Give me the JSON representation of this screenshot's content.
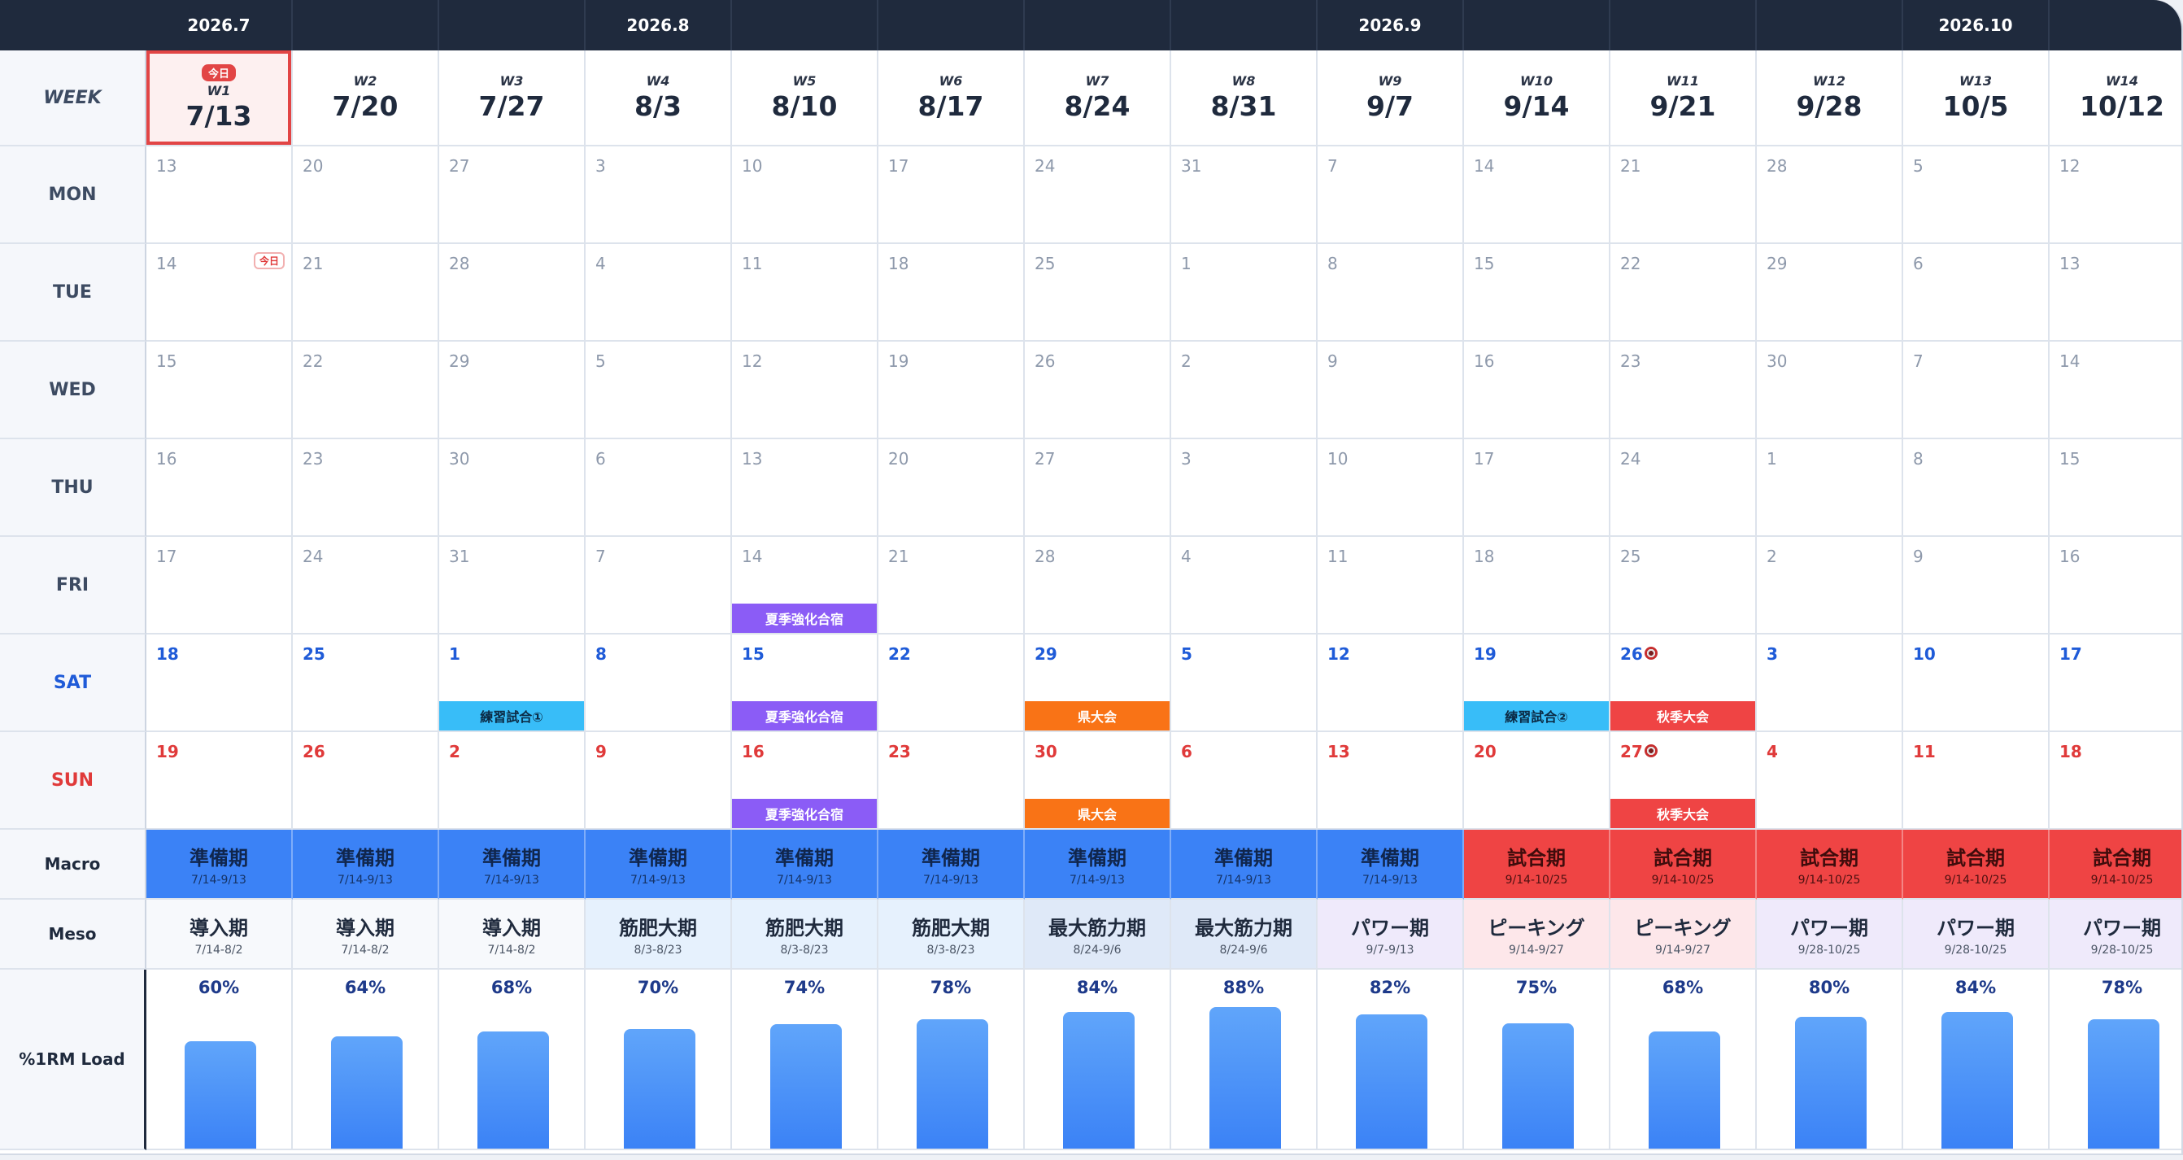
{
  "months": [
    {
      "label": "2026.7",
      "col": 1
    },
    {
      "label": "2026.8",
      "col": 4
    },
    {
      "label": "2026.9",
      "col": 9
    },
    {
      "label": "2026.10",
      "col": 13
    }
  ],
  "labels": {
    "week": "WEEK",
    "days": [
      "MON",
      "TUE",
      "WED",
      "THU",
      "FRI",
      "SAT",
      "SUN"
    ],
    "macro": "Macro",
    "meso": "Meso",
    "load": "%1RM Load",
    "today_badge": "今日",
    "today_tag": "今日"
  },
  "colors": {
    "header_bg": "#1f2a3d",
    "today_outline": "#e24545",
    "macro_prep": "#3b82f6",
    "macro_comp": "#ef4444",
    "event_camp": "#8b5cf6",
    "event_practice": "#38bdf8",
    "event_prefectural": "#f97316",
    "event_autumn": "#ef4444"
  },
  "weeks": [
    {
      "no": "W1",
      "date": "7/13",
      "today": true,
      "days": [
        "13",
        "14",
        "15",
        "16",
        "17",
        "18",
        "19"
      ],
      "macro": {
        "name": "準備期",
        "range": "7/14-9/13",
        "type": "blue"
      },
      "meso": {
        "name": "導入期",
        "range": "7/14-8/2",
        "bg": "#f7f9fc"
      },
      "load": 60,
      "load_label": "60%"
    },
    {
      "no": "W2",
      "date": "7/20",
      "days": [
        "20",
        "21",
        "22",
        "23",
        "24",
        "25",
        "26"
      ],
      "macro": {
        "name": "準備期",
        "range": "7/14-9/13",
        "type": "blue"
      },
      "meso": {
        "name": "導入期",
        "range": "7/14-8/2",
        "bg": "#f7f9fc"
      },
      "load": 64,
      "load_label": "64%"
    },
    {
      "no": "W3",
      "date": "7/27",
      "days": [
        "27",
        "28",
        "29",
        "30",
        "31",
        "1",
        "2"
      ],
      "macro": {
        "name": "準備期",
        "range": "7/14-9/13",
        "type": "blue"
      },
      "meso": {
        "name": "導入期",
        "range": "7/14-8/2",
        "bg": "#f7f9fc"
      },
      "load": 68,
      "load_label": "68%"
    },
    {
      "no": "W4",
      "date": "8/3",
      "days": [
        "3",
        "4",
        "5",
        "6",
        "7",
        "8",
        "9"
      ],
      "macro": {
        "name": "準備期",
        "range": "7/14-9/13",
        "type": "blue"
      },
      "meso": {
        "name": "筋肥大期",
        "range": "8/3-8/23",
        "bg": "#e6f1fd"
      },
      "load": 70,
      "load_label": "70%"
    },
    {
      "no": "W5",
      "date": "8/10",
      "days": [
        "10",
        "11",
        "12",
        "13",
        "14",
        "15",
        "16"
      ],
      "macro": {
        "name": "準備期",
        "range": "7/14-9/13",
        "type": "blue"
      },
      "meso": {
        "name": "筋肥大期",
        "range": "8/3-8/23",
        "bg": "#e6f1fd"
      },
      "load": 74,
      "load_label": "74%"
    },
    {
      "no": "W6",
      "date": "8/17",
      "days": [
        "17",
        "18",
        "19",
        "20",
        "21",
        "22",
        "23"
      ],
      "macro": {
        "name": "準備期",
        "range": "7/14-9/13",
        "type": "blue"
      },
      "meso": {
        "name": "筋肥大期",
        "range": "8/3-8/23",
        "bg": "#e6f1fd"
      },
      "load": 78,
      "load_label": "78%"
    },
    {
      "no": "W7",
      "date": "8/24",
      "days": [
        "24",
        "25",
        "26",
        "27",
        "28",
        "29",
        "30"
      ],
      "macro": {
        "name": "準備期",
        "range": "7/14-9/13",
        "type": "blue"
      },
      "meso": {
        "name": "最大筋力期",
        "range": "8/24-9/6",
        "bg": "#dfe9f8"
      },
      "load": 84,
      "load_label": "84%"
    },
    {
      "no": "W8",
      "date": "8/31",
      "days": [
        "31",
        "1",
        "2",
        "3",
        "4",
        "5",
        "6"
      ],
      "macro": {
        "name": "準備期",
        "range": "7/14-9/13",
        "type": "blue"
      },
      "meso": {
        "name": "最大筋力期",
        "range": "8/24-9/6",
        "bg": "#dfe9f8"
      },
      "load": 88,
      "load_label": "88%"
    },
    {
      "no": "W9",
      "date": "9/7",
      "days": [
        "7",
        "8",
        "9",
        "10",
        "11",
        "12",
        "13"
      ],
      "macro": {
        "name": "準備期",
        "range": "7/14-9/13",
        "type": "blue"
      },
      "meso": {
        "name": "パワー期",
        "range": "9/7-9/13",
        "bg": "#efeafb"
      },
      "load": 82,
      "load_label": "82%"
    },
    {
      "no": "W10",
      "date": "9/14",
      "days": [
        "14",
        "15",
        "16",
        "17",
        "18",
        "19",
        "20"
      ],
      "macro": {
        "name": "試合期",
        "range": "9/14-10/25",
        "type": "red"
      },
      "meso": {
        "name": "ピーキング",
        "range": "9/14-9/27",
        "bg": "#fde7ea"
      },
      "load": 75,
      "load_label": "75%"
    },
    {
      "no": "W11",
      "date": "9/21",
      "days": [
        "21",
        "22",
        "23",
        "24",
        "25",
        "26",
        "27"
      ],
      "macro": {
        "name": "試合期",
        "range": "9/14-10/25",
        "type": "red"
      },
      "meso": {
        "name": "ピーキング",
        "range": "9/14-9/27",
        "bg": "#fde7ea"
      },
      "load": 68,
      "load_label": "68%"
    },
    {
      "no": "W12",
      "date": "9/28",
      "days": [
        "28",
        "29",
        "30",
        "1",
        "2",
        "3",
        "4"
      ],
      "macro": {
        "name": "試合期",
        "range": "9/14-10/25",
        "type": "red"
      },
      "meso": {
        "name": "パワー期",
        "range": "9/28-10/25",
        "bg": "#efeafb"
      },
      "load": 80,
      "load_label": "80%"
    },
    {
      "no": "W13",
      "date": "10/5",
      "days": [
        "5",
        "6",
        "7",
        "8",
        "9",
        "10",
        "11"
      ],
      "macro": {
        "name": "試合期",
        "range": "9/14-10/25",
        "type": "red"
      },
      "meso": {
        "name": "パワー期",
        "range": "9/28-10/25",
        "bg": "#efeafb"
      },
      "load": 84,
      "load_label": "84%"
    },
    {
      "no": "W14",
      "date": "10/12",
      "days": [
        "12",
        "13",
        "14",
        "15",
        "16",
        "17",
        "18"
      ],
      "macro": {
        "name": "試合期",
        "range": "9/14-10/25",
        "type": "red"
      },
      "meso": {
        "name": "パワー期",
        "range": "9/28-10/25",
        "bg": "#efeafb"
      },
      "load": 78,
      "load_label": "78%"
    }
  ],
  "events": [
    {
      "week": 4,
      "day": 4,
      "label": "夏季強化合宿",
      "color": "purple"
    },
    {
      "week": 4,
      "day": 5,
      "label": "夏季強化合宿",
      "color": "purple"
    },
    {
      "week": 4,
      "day": 6,
      "label": "夏季強化合宿",
      "color": "purple"
    },
    {
      "week": 2,
      "day": 5,
      "label": "練習試合①",
      "color": "cyan"
    },
    {
      "week": 6,
      "day": 5,
      "label": "県大会",
      "color": "orange"
    },
    {
      "week": 6,
      "day": 6,
      "label": "県大会",
      "color": "orange"
    },
    {
      "week": 9,
      "day": 5,
      "label": "練習試合②",
      "color": "cyan"
    },
    {
      "week": 10,
      "day": 5,
      "label": "秋季大会",
      "color": "red"
    },
    {
      "week": 10,
      "day": 6,
      "label": "秋季大会",
      "color": "red"
    }
  ],
  "targets": [
    {
      "week": 10,
      "day": 5,
      "icon": "target-icon"
    },
    {
      "week": 10,
      "day": 6,
      "icon": "target-icon"
    }
  ],
  "today_cell": {
    "week": 0,
    "day": 1
  }
}
